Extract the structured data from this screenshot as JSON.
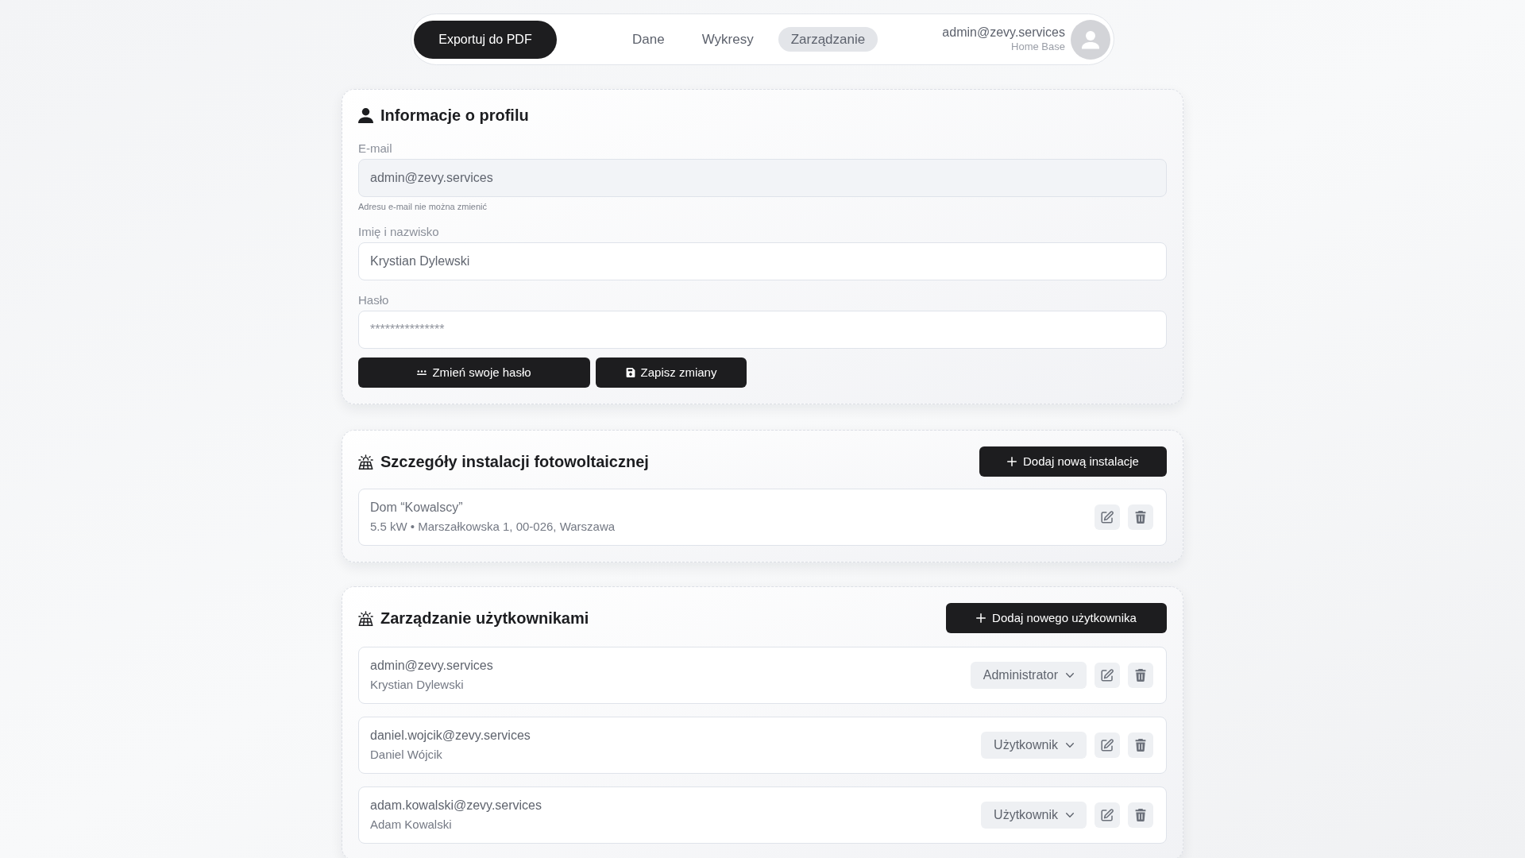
{
  "nav": {
    "export_button": "Exportuj do PDF",
    "tabs": [
      {
        "label": "Dane",
        "selected": false
      },
      {
        "label": "Wykresy",
        "selected": false
      },
      {
        "label": "Zarządzanie",
        "selected": true
      }
    ],
    "user": {
      "email": "admin@zevy.services",
      "subtitle": "Home Base"
    }
  },
  "profile": {
    "title": "Informacje o profilu",
    "fields": [
      {
        "label": "E-mail",
        "value": "admin@zevy.services",
        "disabled": true,
        "hint": "Adresu e-mail nie można zmienić"
      },
      {
        "label": "Imię i nazwisko",
        "value": "Krystian Dylewski",
        "disabled": false
      },
      {
        "label": "Hasło",
        "placeholder": "***************",
        "disabled": false
      }
    ],
    "buttons": [
      {
        "label": "Zmień swoje hasło",
        "kind": "password"
      },
      {
        "label": "Zapisz zmiany",
        "kind": "save"
      }
    ]
  },
  "installations": {
    "title": "Szczegóły instalacji fotowoltaicznej",
    "add_button": "Dodaj nową instalacje",
    "items": [
      {
        "name": "Dom “Kowalscy”",
        "details": "5.5 kW • Marszałkowska 1, 00-026, Warszawa"
      }
    ]
  },
  "users": {
    "title": "Zarządzanie użytkownikami",
    "add_button": "Dodaj nowego użytkownika",
    "items": [
      {
        "email": "admin@zevy.services",
        "name": "Krystian Dylewski",
        "role": "Administrator"
      },
      {
        "email": "daniel.wojcik@zevy.services",
        "name": "Daniel Wójcik",
        "role": "Użytkownik"
      },
      {
        "email": "adam.kowalski@zevy.services",
        "name": "Adam Kowalski",
        "role": "Użytkownik"
      }
    ]
  }
}
